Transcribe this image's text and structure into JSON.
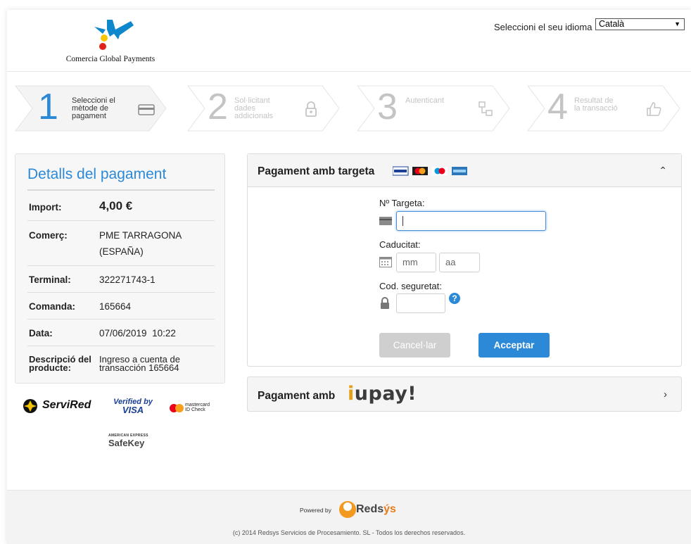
{
  "header": {
    "logo_text": "Comercia Global Payments",
    "language_label": "Seleccioni el seu idioma",
    "language_value": "Català"
  },
  "steps": [
    {
      "number": "1",
      "label_lines": [
        "Seleccioni el",
        "mètode de",
        "pagament"
      ],
      "icon": "credit-card-icon",
      "state": "active"
    },
    {
      "number": "2",
      "label_lines": [
        "Sol·licitant",
        "dades",
        "addicionals"
      ],
      "icon": "lock-icon",
      "state": "inactive"
    },
    {
      "number": "3",
      "label_lines": [
        "Autenticant"
      ],
      "icon": "network-icon",
      "state": "inactive"
    },
    {
      "number": "4",
      "label_lines": [
        "Resultat de",
        "la transacció"
      ],
      "icon": "thumbs-up-icon",
      "state": "inactive"
    }
  ],
  "details": {
    "title": "Detalls del pagament",
    "import_label": "Import:",
    "import_value": "4,00 €",
    "merchant_label": "Comerç:",
    "merchant_value_1": "PME TARRAGONA",
    "merchant_value_2": "(ESPAÑA)",
    "terminal_label": "Terminal:",
    "terminal_value": "322271743-1",
    "order_label": "Comanda:",
    "order_value": "165664",
    "date_label": "Data:",
    "date_value": "07/06/2019  10:22",
    "desc_label_1": "Descripció del",
    "desc_label_2": "producte:",
    "desc_value_1": "Ingreso a cuenta de",
    "desc_value_2": "transacción 165664"
  },
  "brands": {
    "servired": "ServiRed",
    "verified_1": "Verified by",
    "verified_2": "VISA",
    "mastercard_1": "mastercard",
    "mastercard_2": "ID Check",
    "amex_1": "AMERICAN EXPRESS",
    "amex_2": "SafeKey"
  },
  "card_payment": {
    "title": "Pagament amb targeta",
    "card_number_label": "Nº Targeta:",
    "expiry_label": "Caducitat:",
    "month_placeholder": "mm",
    "year_placeholder": "aa",
    "cvv_label": "Cod. seguretat:",
    "cancel_label": "Cancel·lar",
    "accept_label": "Acceptar",
    "card_logos": [
      "visa-logo",
      "mastercard-logo",
      "maestro-logo",
      "amex-logo"
    ]
  },
  "iupay": {
    "title": "Pagament amb",
    "logo_i": "i",
    "logo_rest": "upay!"
  },
  "footer": {
    "powered_by": "Powered by",
    "redsys_1": "Reds",
    "redsys_2": "ýs",
    "copyright": "(c) 2014 Redsys Servicios de Procesamiento. SL - Todos los derechos reservados."
  },
  "colors": {
    "accent": "#2b89d8",
    "redsys_orange": "#e77b1b",
    "button_disabled": "#cfcfcf"
  }
}
